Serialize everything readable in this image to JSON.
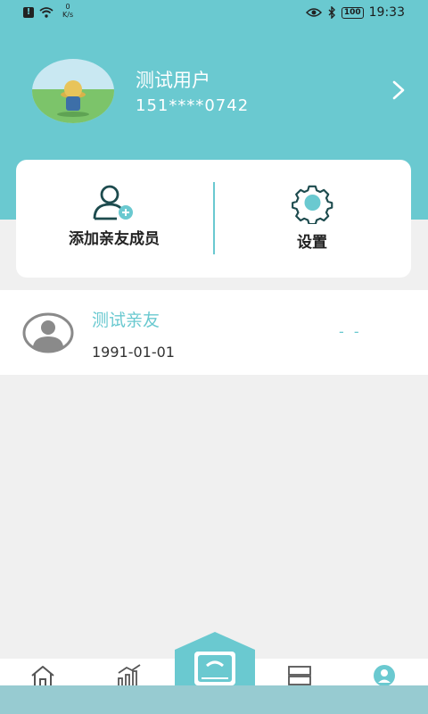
{
  "status_bar": {
    "speed_value": "0",
    "speed_unit": "K/s",
    "battery": "100",
    "time": "19:33"
  },
  "profile": {
    "name": "测试用户",
    "phone": "151****0742"
  },
  "actions": {
    "add_member_label": "添加亲友成员",
    "settings_label": "设置"
  },
  "friends": [
    {
      "name": "测试亲友",
      "birthday": "1991-01-01",
      "value": "- -"
    }
  ],
  "colors": {
    "accent": "#6ac9d0",
    "background": "#f0f0f0"
  },
  "tabs": [
    {
      "icon": "home-icon"
    },
    {
      "icon": "trend-chart-icon"
    },
    {
      "icon": "scale-icon"
    },
    {
      "icon": "records-icon"
    },
    {
      "icon": "user-group-icon"
    }
  ]
}
